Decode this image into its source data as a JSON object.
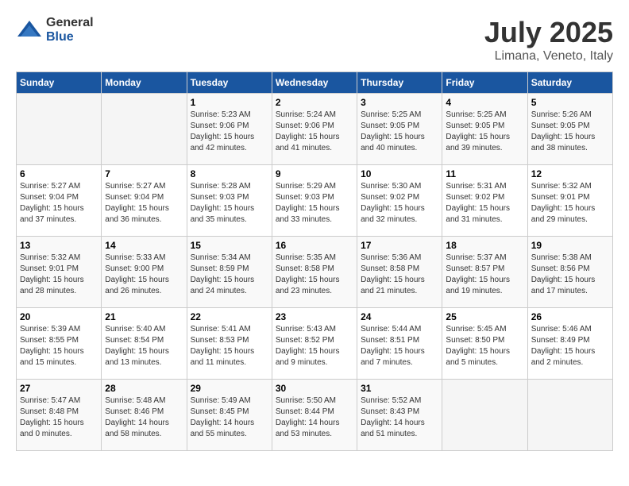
{
  "logo": {
    "text_general": "General",
    "text_blue": "Blue"
  },
  "header": {
    "title": "July 2025",
    "subtitle": "Limana, Veneto, Italy"
  },
  "weekdays": [
    "Sunday",
    "Monday",
    "Tuesday",
    "Wednesday",
    "Thursday",
    "Friday",
    "Saturday"
  ],
  "weeks": [
    [
      {
        "day": "",
        "sunrise": "",
        "sunset": "",
        "daylight": ""
      },
      {
        "day": "",
        "sunrise": "",
        "sunset": "",
        "daylight": ""
      },
      {
        "day": "1",
        "sunrise": "Sunrise: 5:23 AM",
        "sunset": "Sunset: 9:06 PM",
        "daylight": "Daylight: 15 hours and 42 minutes."
      },
      {
        "day": "2",
        "sunrise": "Sunrise: 5:24 AM",
        "sunset": "Sunset: 9:06 PM",
        "daylight": "Daylight: 15 hours and 41 minutes."
      },
      {
        "day": "3",
        "sunrise": "Sunrise: 5:25 AM",
        "sunset": "Sunset: 9:05 PM",
        "daylight": "Daylight: 15 hours and 40 minutes."
      },
      {
        "day": "4",
        "sunrise": "Sunrise: 5:25 AM",
        "sunset": "Sunset: 9:05 PM",
        "daylight": "Daylight: 15 hours and 39 minutes."
      },
      {
        "day": "5",
        "sunrise": "Sunrise: 5:26 AM",
        "sunset": "Sunset: 9:05 PM",
        "daylight": "Daylight: 15 hours and 38 minutes."
      }
    ],
    [
      {
        "day": "6",
        "sunrise": "Sunrise: 5:27 AM",
        "sunset": "Sunset: 9:04 PM",
        "daylight": "Daylight: 15 hours and 37 minutes."
      },
      {
        "day": "7",
        "sunrise": "Sunrise: 5:27 AM",
        "sunset": "Sunset: 9:04 PM",
        "daylight": "Daylight: 15 hours and 36 minutes."
      },
      {
        "day": "8",
        "sunrise": "Sunrise: 5:28 AM",
        "sunset": "Sunset: 9:03 PM",
        "daylight": "Daylight: 15 hours and 35 minutes."
      },
      {
        "day": "9",
        "sunrise": "Sunrise: 5:29 AM",
        "sunset": "Sunset: 9:03 PM",
        "daylight": "Daylight: 15 hours and 33 minutes."
      },
      {
        "day": "10",
        "sunrise": "Sunrise: 5:30 AM",
        "sunset": "Sunset: 9:02 PM",
        "daylight": "Daylight: 15 hours and 32 minutes."
      },
      {
        "day": "11",
        "sunrise": "Sunrise: 5:31 AM",
        "sunset": "Sunset: 9:02 PM",
        "daylight": "Daylight: 15 hours and 31 minutes."
      },
      {
        "day": "12",
        "sunrise": "Sunrise: 5:32 AM",
        "sunset": "Sunset: 9:01 PM",
        "daylight": "Daylight: 15 hours and 29 minutes."
      }
    ],
    [
      {
        "day": "13",
        "sunrise": "Sunrise: 5:32 AM",
        "sunset": "Sunset: 9:01 PM",
        "daylight": "Daylight: 15 hours and 28 minutes."
      },
      {
        "day": "14",
        "sunrise": "Sunrise: 5:33 AM",
        "sunset": "Sunset: 9:00 PM",
        "daylight": "Daylight: 15 hours and 26 minutes."
      },
      {
        "day": "15",
        "sunrise": "Sunrise: 5:34 AM",
        "sunset": "Sunset: 8:59 PM",
        "daylight": "Daylight: 15 hours and 24 minutes."
      },
      {
        "day": "16",
        "sunrise": "Sunrise: 5:35 AM",
        "sunset": "Sunset: 8:58 PM",
        "daylight": "Daylight: 15 hours and 23 minutes."
      },
      {
        "day": "17",
        "sunrise": "Sunrise: 5:36 AM",
        "sunset": "Sunset: 8:58 PM",
        "daylight": "Daylight: 15 hours and 21 minutes."
      },
      {
        "day": "18",
        "sunrise": "Sunrise: 5:37 AM",
        "sunset": "Sunset: 8:57 PM",
        "daylight": "Daylight: 15 hours and 19 minutes."
      },
      {
        "day": "19",
        "sunrise": "Sunrise: 5:38 AM",
        "sunset": "Sunset: 8:56 PM",
        "daylight": "Daylight: 15 hours and 17 minutes."
      }
    ],
    [
      {
        "day": "20",
        "sunrise": "Sunrise: 5:39 AM",
        "sunset": "Sunset: 8:55 PM",
        "daylight": "Daylight: 15 hours and 15 minutes."
      },
      {
        "day": "21",
        "sunrise": "Sunrise: 5:40 AM",
        "sunset": "Sunset: 8:54 PM",
        "daylight": "Daylight: 15 hours and 13 minutes."
      },
      {
        "day": "22",
        "sunrise": "Sunrise: 5:41 AM",
        "sunset": "Sunset: 8:53 PM",
        "daylight": "Daylight: 15 hours and 11 minutes."
      },
      {
        "day": "23",
        "sunrise": "Sunrise: 5:43 AM",
        "sunset": "Sunset: 8:52 PM",
        "daylight": "Daylight: 15 hours and 9 minutes."
      },
      {
        "day": "24",
        "sunrise": "Sunrise: 5:44 AM",
        "sunset": "Sunset: 8:51 PM",
        "daylight": "Daylight: 15 hours and 7 minutes."
      },
      {
        "day": "25",
        "sunrise": "Sunrise: 5:45 AM",
        "sunset": "Sunset: 8:50 PM",
        "daylight": "Daylight: 15 hours and 5 minutes."
      },
      {
        "day": "26",
        "sunrise": "Sunrise: 5:46 AM",
        "sunset": "Sunset: 8:49 PM",
        "daylight": "Daylight: 15 hours and 2 minutes."
      }
    ],
    [
      {
        "day": "27",
        "sunrise": "Sunrise: 5:47 AM",
        "sunset": "Sunset: 8:48 PM",
        "daylight": "Daylight: 15 hours and 0 minutes."
      },
      {
        "day": "28",
        "sunrise": "Sunrise: 5:48 AM",
        "sunset": "Sunset: 8:46 PM",
        "daylight": "Daylight: 14 hours and 58 minutes."
      },
      {
        "day": "29",
        "sunrise": "Sunrise: 5:49 AM",
        "sunset": "Sunset: 8:45 PM",
        "daylight": "Daylight: 14 hours and 55 minutes."
      },
      {
        "day": "30",
        "sunrise": "Sunrise: 5:50 AM",
        "sunset": "Sunset: 8:44 PM",
        "daylight": "Daylight: 14 hours and 53 minutes."
      },
      {
        "day": "31",
        "sunrise": "Sunrise: 5:52 AM",
        "sunset": "Sunset: 8:43 PM",
        "daylight": "Daylight: 14 hours and 51 minutes."
      },
      {
        "day": "",
        "sunrise": "",
        "sunset": "",
        "daylight": ""
      },
      {
        "day": "",
        "sunrise": "",
        "sunset": "",
        "daylight": ""
      }
    ]
  ]
}
